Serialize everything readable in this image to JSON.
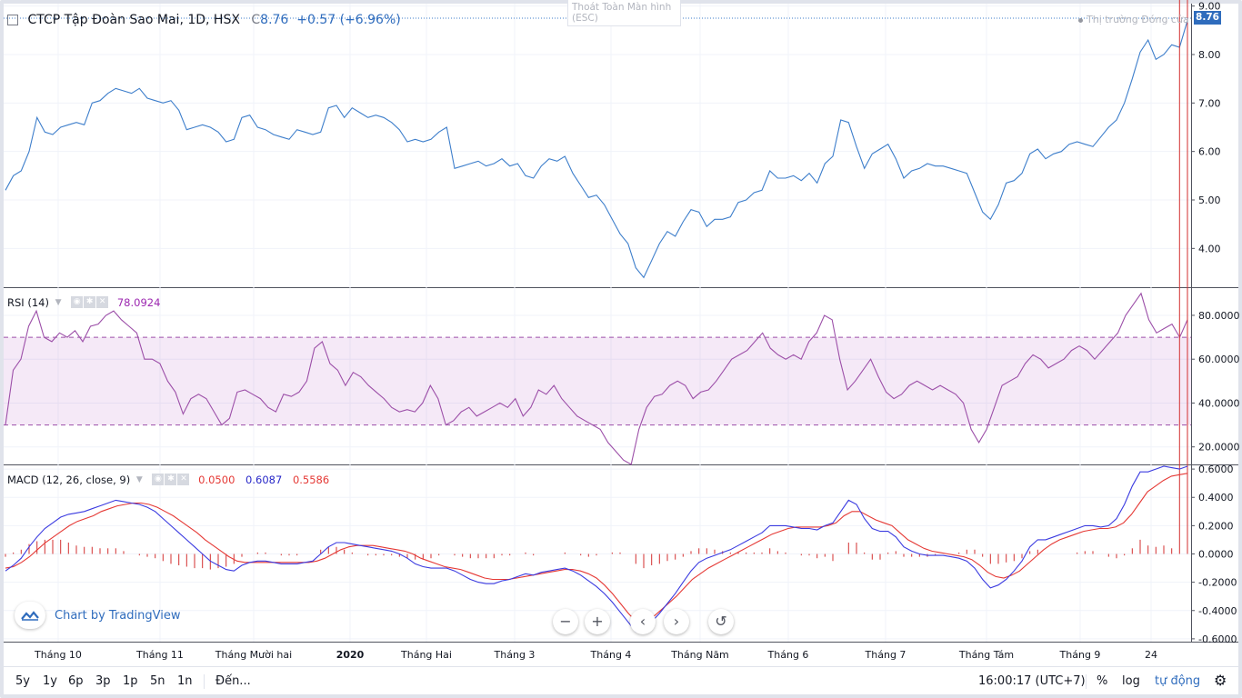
{
  "main_legend": {
    "title": "CTCP Tập Đoàn Sao Mai, 1D, HSX",
    "close_label": "C",
    "close_value": "8.76",
    "change": "+0.57 (+6.96%)"
  },
  "exit_fullscreen": {
    "label": "Thoát Toàn Màn hình",
    "shortcut": "(ESC)"
  },
  "market_status": "Thị trường Đóng cửa",
  "last_price_badge": "8.76",
  "rsi_legend": {
    "name": "RSI (14)",
    "value": "78.0924"
  },
  "macd_legend": {
    "name": "MACD (12, 26, close, 9)",
    "hist": "0.0500",
    "macd": "0.6087",
    "signal": "0.5586"
  },
  "watermark": "Chart by TradingView",
  "time_axis": [
    "Tháng 10",
    "Tháng 11",
    "Tháng Mười hai",
    "2020",
    "Tháng Hai",
    "Tháng 3",
    "Tháng 4",
    "Tháng Năm",
    "Tháng 6",
    "Tháng 7",
    "Tháng Tám",
    "Tháng 9",
    "24"
  ],
  "price_axis": [
    "9.00",
    "8.00",
    "7.00",
    "6.00",
    "5.00",
    "4.00"
  ],
  "rsi_axis": [
    "80.0000",
    "60.0000",
    "40.0000",
    "20.0000"
  ],
  "macd_axis": [
    "0.6000",
    "0.4000",
    "0.2000",
    "0.0000",
    "-0.2000",
    "-0.4000",
    "-0.6000"
  ],
  "bottom": {
    "ranges": [
      "5y",
      "1y",
      "6p",
      "3p",
      "1p",
      "5n",
      "1n"
    ],
    "goto": "Đến...",
    "clock": "16:00:17 (UTC+7)",
    "percent": "%",
    "log": "log",
    "auto": "tự động"
  },
  "colors": {
    "price": "#3d7ecb",
    "rsi": "#9c4fa8",
    "macd": "#3a3ae0",
    "signal": "#e53935",
    "hist": "#d32f2f",
    "accent": "#2f6cbd"
  },
  "chart_data": [
    {
      "type": "line",
      "series": [
        {
          "values": [
            5.2,
            5.5,
            5.6,
            6.0,
            6.7,
            6.4,
            6.35,
            6.5,
            6.55,
            6.6,
            6.55,
            7.0,
            7.05,
            7.2,
            7.3,
            7.25,
            7.2,
            7.3,
            7.1,
            7.05,
            7.0,
            7.05,
            6.85,
            6.45,
            6.5,
            6.55,
            6.5,
            6.4,
            6.2,
            6.25,
            6.7,
            6.75,
            6.5,
            6.45,
            6.35,
            6.3,
            6.25,
            6.45,
            6.4,
            6.35,
            6.4,
            6.9,
            6.95,
            6.7,
            6.9,
            6.8,
            6.7,
            6.75,
            6.7,
            6.6,
            6.45,
            6.2,
            6.25,
            6.2,
            6.25,
            6.4,
            6.5,
            5.65,
            5.7,
            5.75,
            5.8,
            5.7,
            5.75,
            5.85,
            5.7,
            5.75,
            5.5,
            5.45,
            5.7,
            5.85,
            5.8,
            5.9,
            5.55,
            5.3,
            5.05,
            5.1,
            4.9,
            4.6,
            4.3,
            4.1,
            3.6,
            3.4,
            3.75,
            4.1,
            4.35,
            4.25,
            4.55,
            4.8,
            4.75,
            4.45,
            4.6,
            4.6,
            4.65,
            4.95,
            5.0,
            5.15,
            5.2,
            5.6,
            5.45,
            5.45,
            5.5,
            5.4,
            5.55,
            5.35,
            5.75,
            5.9,
            6.65,
            6.6,
            6.1,
            5.65,
            5.95,
            6.05,
            6.15,
            5.85,
            5.45,
            5.6,
            5.65,
            5.75,
            5.7,
            5.7,
            5.65,
            5.6,
            5.55,
            5.15,
            4.75,
            4.6,
            4.9,
            5.35,
            5.4,
            5.55,
            5.95,
            6.05,
            5.85,
            5.95,
            6.0,
            6.15,
            6.2,
            6.15,
            6.1,
            6.3,
            6.5,
            6.65,
            7.0,
            7.5,
            8.05,
            8.3,
            7.9,
            8.0,
            8.2,
            8.15,
            8.7
          ]
        }
      ],
      "ylim": [
        3.2,
        9.05
      ]
    },
    {
      "type": "line",
      "series": [
        {
          "values": [
            30,
            55,
            60,
            75,
            82,
            70,
            68,
            72,
            70,
            73,
            68,
            75,
            76,
            80,
            82,
            78,
            75,
            72,
            60,
            60,
            58,
            50,
            45,
            35,
            42,
            44,
            42,
            36,
            30,
            33,
            45,
            46,
            44,
            42,
            38,
            36,
            44,
            43,
            45,
            50,
            65,
            68,
            58,
            55,
            48,
            54,
            52,
            48,
            45,
            42,
            38,
            36,
            37,
            36,
            40,
            48,
            42,
            30,
            32,
            36,
            38,
            34,
            36,
            38,
            40,
            38,
            42,
            34,
            38,
            46,
            44,
            48,
            42,
            38,
            34,
            32,
            30,
            28,
            22,
            18,
            14,
            12,
            28,
            38,
            43,
            44,
            48,
            50,
            48,
            42,
            45,
            46,
            50,
            55,
            60,
            62,
            64,
            68,
            72,
            65,
            62,
            60,
            62,
            60,
            68,
            72,
            80,
            78,
            60,
            46,
            50,
            55,
            60,
            52,
            45,
            42,
            44,
            48,
            50,
            48,
            46,
            48,
            46,
            44,
            40,
            28,
            22,
            28,
            38,
            48,
            50,
            52,
            58,
            62,
            60,
            56,
            58,
            60,
            64,
            66,
            64,
            60,
            64,
            68,
            72,
            80,
            85,
            90,
            78,
            72,
            74,
            76,
            70,
            78
          ]
        }
      ],
      "ylim": [
        12,
        92
      ],
      "bands": [
        30,
        70
      ]
    },
    {
      "type": "line",
      "series": [
        {
          "name": "MACD",
          "values": [
            -0.12,
            -0.08,
            -0.03,
            0.05,
            0.12,
            0.18,
            0.22,
            0.26,
            0.28,
            0.29,
            0.3,
            0.32,
            0.34,
            0.36,
            0.38,
            0.37,
            0.36,
            0.35,
            0.33,
            0.3,
            0.25,
            0.2,
            0.15,
            0.1,
            0.05,
            0.0,
            -0.05,
            -0.08,
            -0.11,
            -0.12,
            -0.08,
            -0.06,
            -0.05,
            -0.05,
            -0.06,
            -0.07,
            -0.07,
            -0.07,
            -0.06,
            -0.05,
            0.0,
            0.05,
            0.08,
            0.08,
            0.07,
            0.06,
            0.05,
            0.04,
            0.03,
            0.02,
            0.0,
            -0.03,
            -0.07,
            -0.09,
            -0.1,
            -0.1,
            -0.1,
            -0.12,
            -0.15,
            -0.18,
            -0.2,
            -0.21,
            -0.21,
            -0.19,
            -0.18,
            -0.16,
            -0.14,
            -0.15,
            -0.13,
            -0.12,
            -0.11,
            -0.1,
            -0.12,
            -0.15,
            -0.19,
            -0.23,
            -0.28,
            -0.34,
            -0.41,
            -0.48,
            -0.55,
            -0.55,
            -0.48,
            -0.42,
            -0.35,
            -0.28,
            -0.2,
            -0.12,
            -0.06,
            -0.03,
            -0.01,
            0.01,
            0.03,
            0.06,
            0.09,
            0.12,
            0.15,
            0.2,
            0.2,
            0.2,
            0.19,
            0.18,
            0.18,
            0.17,
            0.2,
            0.22,
            0.3,
            0.38,
            0.35,
            0.25,
            0.18,
            0.16,
            0.16,
            0.12,
            0.05,
            0.02,
            0.0,
            -0.01,
            -0.01,
            -0.01,
            -0.02,
            -0.03,
            -0.05,
            -0.1,
            -0.18,
            -0.24,
            -0.22,
            -0.18,
            -0.12,
            -0.05,
            0.05,
            0.1,
            0.1,
            0.12,
            0.14,
            0.16,
            0.18,
            0.2,
            0.2,
            0.19,
            0.2,
            0.25,
            0.35,
            0.48,
            0.58,
            0.58,
            0.6,
            0.62,
            0.61,
            0.6,
            0.62
          ]
        },
        {
          "name": "Signal",
          "values": [
            -0.1,
            -0.09,
            -0.06,
            -0.02,
            0.03,
            0.08,
            0.12,
            0.16,
            0.2,
            0.23,
            0.25,
            0.27,
            0.3,
            0.32,
            0.34,
            0.35,
            0.36,
            0.36,
            0.35,
            0.33,
            0.3,
            0.27,
            0.23,
            0.19,
            0.15,
            0.1,
            0.06,
            0.02,
            -0.02,
            -0.05,
            -0.06,
            -0.06,
            -0.06,
            -0.06,
            -0.06,
            -0.06,
            -0.06,
            -0.06,
            -0.06,
            -0.05,
            -0.03,
            0.0,
            0.03,
            0.05,
            0.06,
            0.06,
            0.06,
            0.05,
            0.04,
            0.03,
            0.02,
            0.0,
            -0.03,
            -0.05,
            -0.07,
            -0.09,
            -0.1,
            -0.11,
            -0.13,
            -0.15,
            -0.17,
            -0.18,
            -0.18,
            -0.18,
            -0.17,
            -0.16,
            -0.15,
            -0.14,
            -0.13,
            -0.12,
            -0.11,
            -0.11,
            -0.12,
            -0.14,
            -0.17,
            -0.22,
            -0.28,
            -0.35,
            -0.42,
            -0.48,
            -0.48,
            -0.45,
            -0.4,
            -0.35,
            -0.3,
            -0.24,
            -0.18,
            -0.14,
            -0.1,
            -0.07,
            -0.04,
            -0.01,
            0.02,
            0.05,
            0.08,
            0.11,
            0.14,
            0.16,
            0.18,
            0.19,
            0.19,
            0.19,
            0.19,
            0.2,
            0.22,
            0.27,
            0.3,
            0.3,
            0.27,
            0.24,
            0.22,
            0.2,
            0.15,
            0.1,
            0.07,
            0.04,
            0.02,
            0.01,
            0.0,
            -0.01,
            -0.02,
            -0.04,
            -0.08,
            -0.13,
            -0.16,
            -0.17,
            -0.15,
            -0.12,
            -0.07,
            -0.02,
            0.03,
            0.07,
            0.1,
            0.12,
            0.14,
            0.16,
            0.17,
            0.18,
            0.18,
            0.19,
            0.22,
            0.28,
            0.36,
            0.44,
            0.48,
            0.52,
            0.55,
            0.56,
            0.57
          ]
        }
      ],
      "ylim": [
        -0.62,
        0.62
      ]
    }
  ]
}
